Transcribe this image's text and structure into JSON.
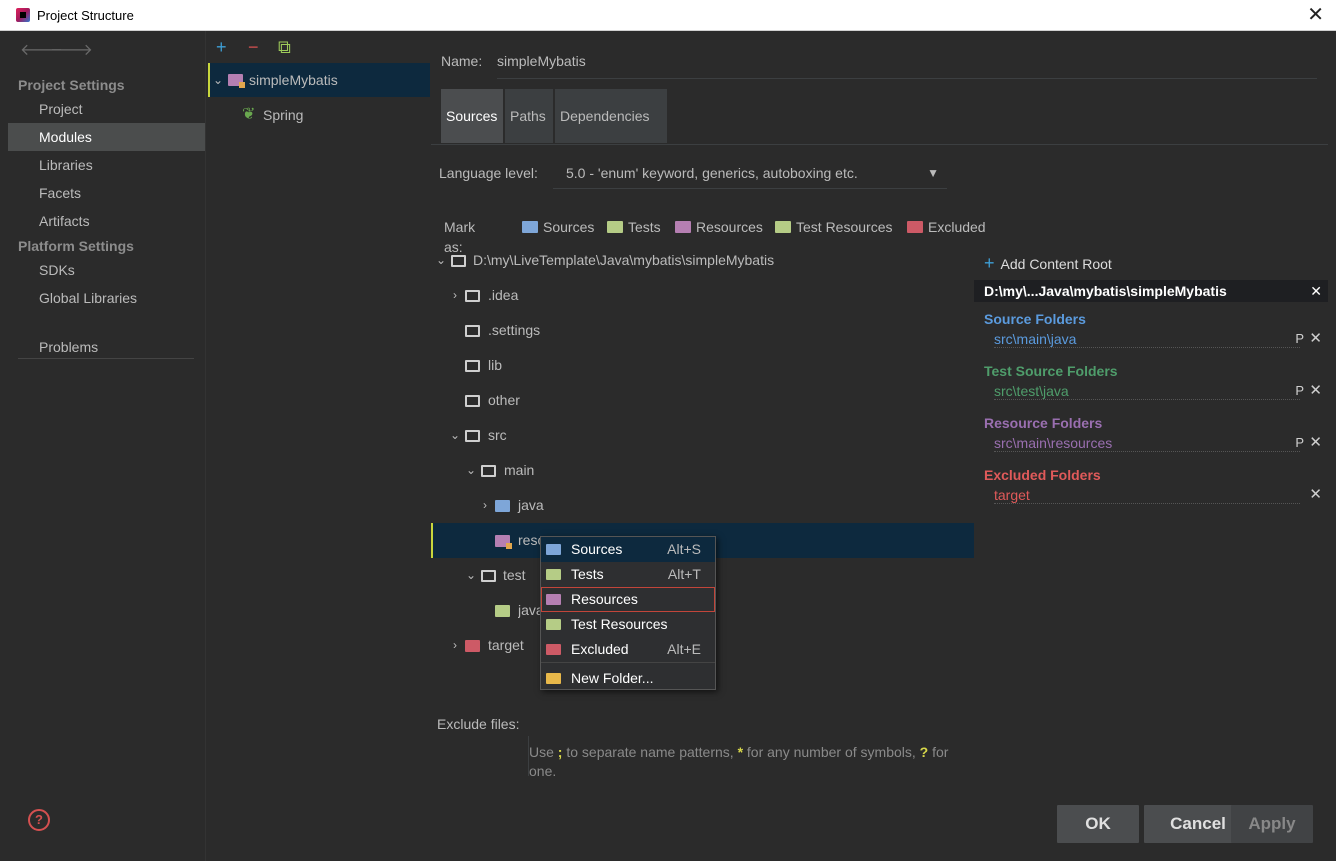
{
  "window": {
    "title": "Project Structure",
    "close": "✕"
  },
  "nav": {
    "back": "🡐",
    "forward": "🡒",
    "project_settings_header": "Project Settings",
    "project_settings": [
      "Project",
      "Modules",
      "Libraries",
      "Facets",
      "Artifacts"
    ],
    "platform_settings_header": "Platform Settings",
    "platform_settings": [
      "SDKs",
      "Global Libraries"
    ],
    "problems": "Problems",
    "selected": "Modules"
  },
  "modules": {
    "toolbar": {
      "add": "+",
      "remove": "−",
      "copy": "⧉"
    },
    "items": [
      {
        "label": "simpleMybatis"
      },
      {
        "label": "Spring"
      }
    ]
  },
  "module": {
    "name_label": "Name:",
    "name_value": "simpleMybatis",
    "tabs": [
      "Sources",
      "Paths",
      "Dependencies"
    ],
    "active_tab": "Sources",
    "language_level_label": "Language level:",
    "language_level_value": "5.0 - 'enum' keyword, generics, autoboxing etc.",
    "mark_as_label": "Mark as:",
    "mark_as": [
      "Sources",
      "Tests",
      "Resources",
      "Test Resources",
      "Excluded"
    ]
  },
  "tree": {
    "root": "D:\\my\\LiveTemplate\\Java\\mybatis\\simpleMybatis",
    "items": [
      ".idea",
      ".settings",
      "lib",
      "other",
      "src",
      "main",
      "java",
      "resources",
      "test",
      "java",
      "target"
    ]
  },
  "side": {
    "add_content_root": "Add Content Root",
    "root_header": "D:\\my\\...Java\\mybatis\\simpleMybatis",
    "source_folders_title": "Source Folders",
    "source_folders_path": "src\\main\\java",
    "test_source_folders_title": "Test Source Folders",
    "test_source_folders_path": "src\\test\\java",
    "resource_folders_title": "Resource Folders",
    "resource_folders_path": "src\\main\\resources",
    "excluded_folders_title": "Excluded Folders",
    "excluded_folders_path": "target",
    "p_glyph": "P",
    "x_glyph": "✕"
  },
  "context_menu": {
    "items": [
      {
        "label": "Sources",
        "shortcut": "Alt+S"
      },
      {
        "label": "Tests",
        "shortcut": "Alt+T"
      },
      {
        "label": "Resources",
        "shortcut": ""
      },
      {
        "label": "Test Resources",
        "shortcut": ""
      },
      {
        "label": "Excluded",
        "shortcut": "Alt+E"
      },
      {
        "label": "New Folder...",
        "shortcut": ""
      }
    ],
    "hovered": "Sources",
    "boxed": "Resources"
  },
  "exclude": {
    "label": "Exclude files:",
    "hint_1": "Use ",
    "hint_sym1": ";",
    "hint_2": " to separate name patterns, ",
    "hint_sym2": "*",
    "hint_3": " for any number of symbols, ",
    "hint_sym3": "?",
    "hint_4": " for one."
  },
  "footer": {
    "help": "?",
    "ok": "OK",
    "cancel": "Cancel",
    "apply": "Apply"
  },
  "colors": {
    "sources": "#7ea6d8",
    "tests": "#b5cc86",
    "resources": "#b57fb2",
    "excluded": "#cd5a66",
    "accent_plus": "#3e9fd6",
    "source_title": "#5b9bde",
    "test_title": "#4f9d6b",
    "resource_title": "#9a6fb0",
    "excluded_title": "#e05a5a"
  }
}
